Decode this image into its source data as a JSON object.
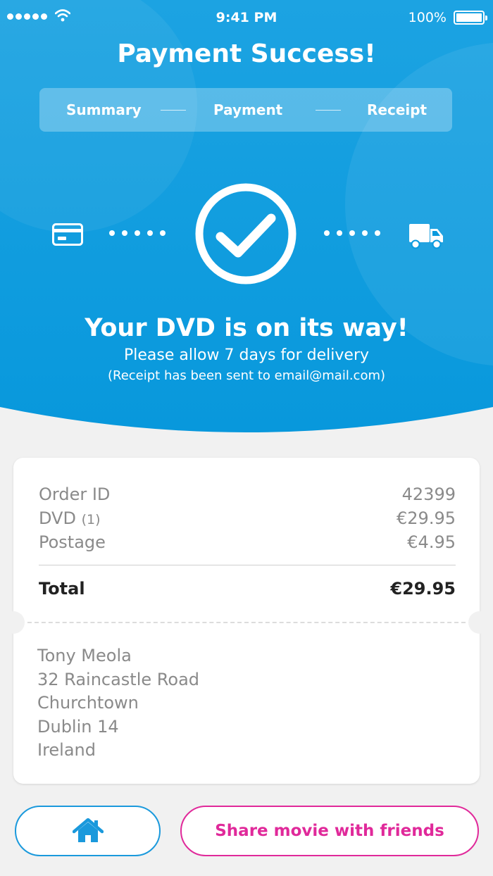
{
  "status_bar": {
    "time": "9:41 PM",
    "battery": "100%"
  },
  "header": {
    "title": "Payment Success!"
  },
  "steps": [
    "Summary",
    "Payment",
    "Receipt"
  ],
  "confirmation": {
    "headline": "Your DVD is on its way!",
    "subline": "Please allow 7 days for delivery",
    "note": "(Receipt has been sent to email@mail.com)"
  },
  "order": {
    "order_id_label": "Order ID",
    "order_id": "42399",
    "item_label": "DVD",
    "item_qty": "(1)",
    "item_price": "€29.95",
    "postage_label": "Postage",
    "postage": "€4.95",
    "total_label": "Total",
    "total": "€29.95"
  },
  "address": [
    "Tony Meola",
    "32 Raincastle Road",
    "Churchtown",
    "Dublin 14",
    "Ireland"
  ],
  "actions": {
    "share_label": "Share movie with friends"
  },
  "icons": [
    "signal-icon",
    "wifi-icon",
    "battery-icon",
    "credit-card-icon",
    "check-circle-icon",
    "delivery-truck-icon",
    "home-icon"
  ],
  "colors": {
    "primary_blue": "#0b9de0",
    "accent_pink": "#e0299a",
    "home_blue": "#1a99dc"
  }
}
